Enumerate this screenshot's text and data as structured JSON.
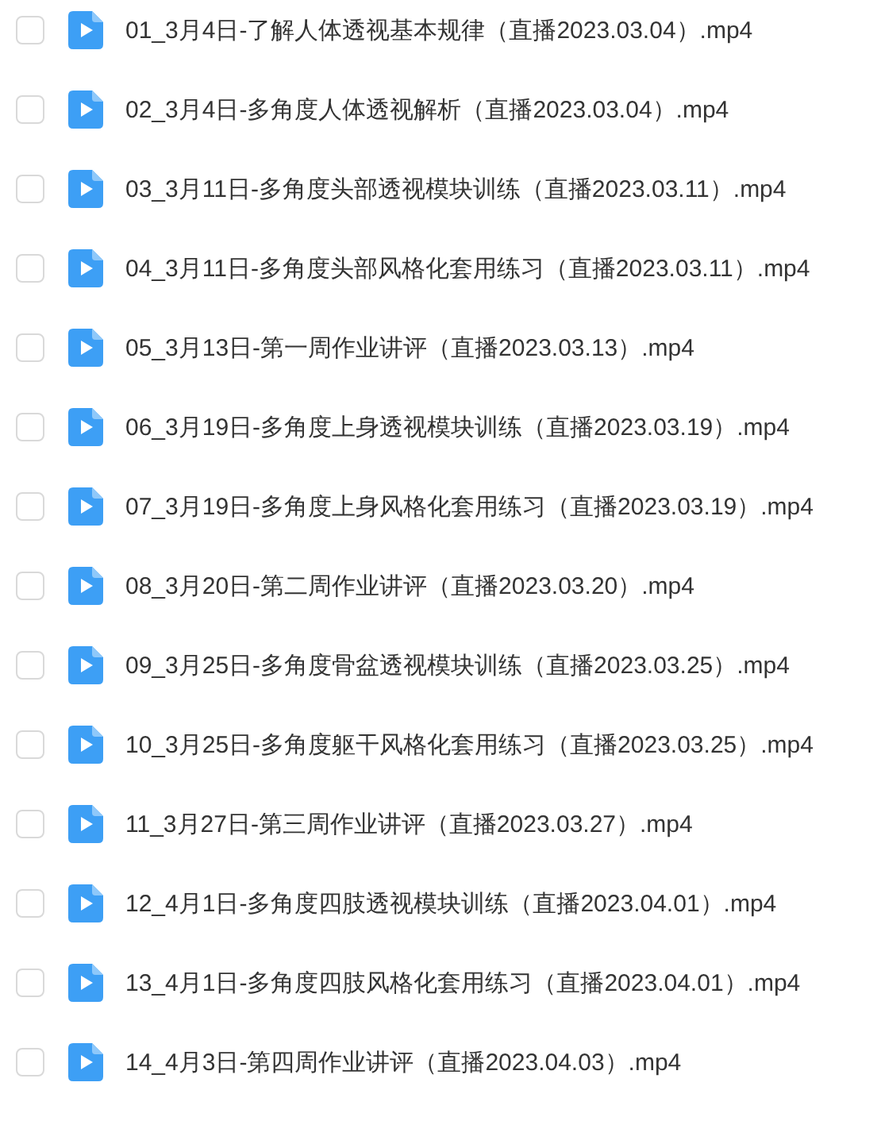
{
  "files": [
    {
      "name": "01_3月4日-了解人体透视基本规律（直播2023.03.04）.mp4",
      "checked": false
    },
    {
      "name": "02_3月4日-多角度人体透视解析（直播2023.03.04）.mp4",
      "checked": false
    },
    {
      "name": "03_3月11日-多角度头部透视模块训练（直播2023.03.11）.mp4",
      "checked": false
    },
    {
      "name": "04_3月11日-多角度头部风格化套用练习（直播2023.03.11）.mp4",
      "checked": false
    },
    {
      "name": "05_3月13日-第一周作业讲评（直播2023.03.13）.mp4",
      "checked": false
    },
    {
      "name": "06_3月19日-多角度上身透视模块训练（直播2023.03.19）.mp4",
      "checked": false
    },
    {
      "name": "07_3月19日-多角度上身风格化套用练习（直播2023.03.19）.mp4",
      "checked": false
    },
    {
      "name": "08_3月20日-第二周作业讲评（直播2023.03.20）.mp4",
      "checked": false
    },
    {
      "name": "09_3月25日-多角度骨盆透视模块训练（直播2023.03.25）.mp4",
      "checked": false
    },
    {
      "name": "10_3月25日-多角度躯干风格化套用练习（直播2023.03.25）.mp4",
      "checked": false
    },
    {
      "name": "11_3月27日-第三周作业讲评（直播2023.03.27）.mp4",
      "checked": false
    },
    {
      "name": "12_4月1日-多角度四肢透视模块训练（直播2023.04.01）.mp4",
      "checked": false
    },
    {
      "name": "13_4月1日-多角度四肢风格化套用练习（直播2023.04.01）.mp4",
      "checked": false
    },
    {
      "name": "14_4月3日-第四周作业讲评（直播2023.04.03）.mp4",
      "checked": false
    }
  ]
}
